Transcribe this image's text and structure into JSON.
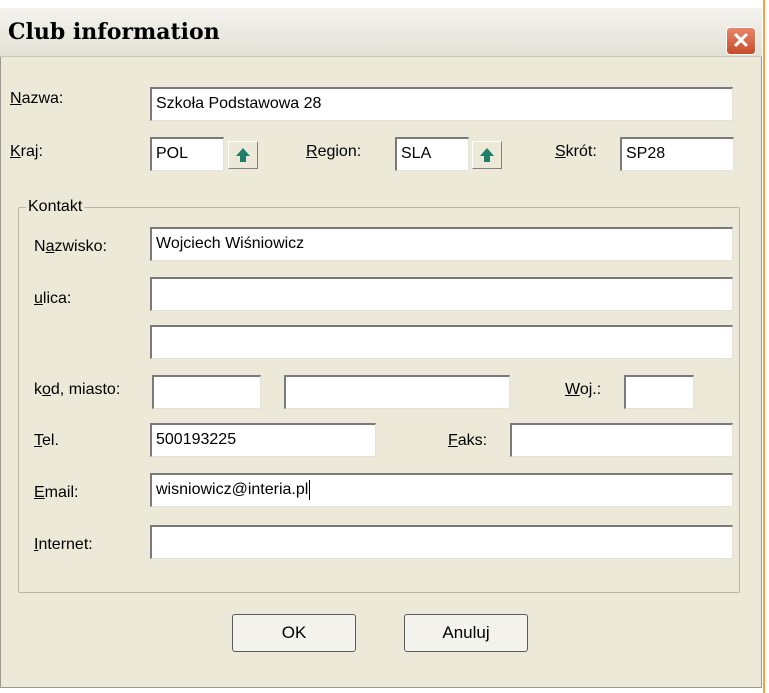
{
  "window": {
    "title": "Club information",
    "close_label": "✕"
  },
  "fields": {
    "nazwa": {
      "label": "Nazwa:",
      "value": "Szkoła Podstawowa 28"
    },
    "kraj": {
      "label": "Kraj:",
      "value": "POL"
    },
    "region": {
      "label": "Region:",
      "value": "SLA"
    },
    "skrot": {
      "label": "Skrót:",
      "value": "SP28"
    }
  },
  "kontakt": {
    "legend": "Kontakt",
    "nazwisko": {
      "label": "Nazwisko:",
      "value": "Wojciech Wiśniowicz"
    },
    "ulica": {
      "label": "ulica:",
      "value1": "",
      "value2": ""
    },
    "kod_miasto": {
      "label": "kod, miasto:",
      "kod": "",
      "miasto": ""
    },
    "woj": {
      "label": "Woj.:",
      "value": ""
    },
    "tel": {
      "label": "Tel.",
      "value": "500193225"
    },
    "faks": {
      "label": "Faks:",
      "value": ""
    },
    "email": {
      "label": "Email:",
      "value": "wisniowicz@interia.pl"
    },
    "internet": {
      "label": "Internet:",
      "value": ""
    }
  },
  "buttons": {
    "ok": "OK",
    "cancel": "Anuluj"
  },
  "icons": {
    "up": "up-arrow-icon",
    "close": "close-icon"
  },
  "colors": {
    "arrow": "#1f7f6a",
    "close_bg": "#d9603f",
    "window_bg": "#ece9d8"
  }
}
